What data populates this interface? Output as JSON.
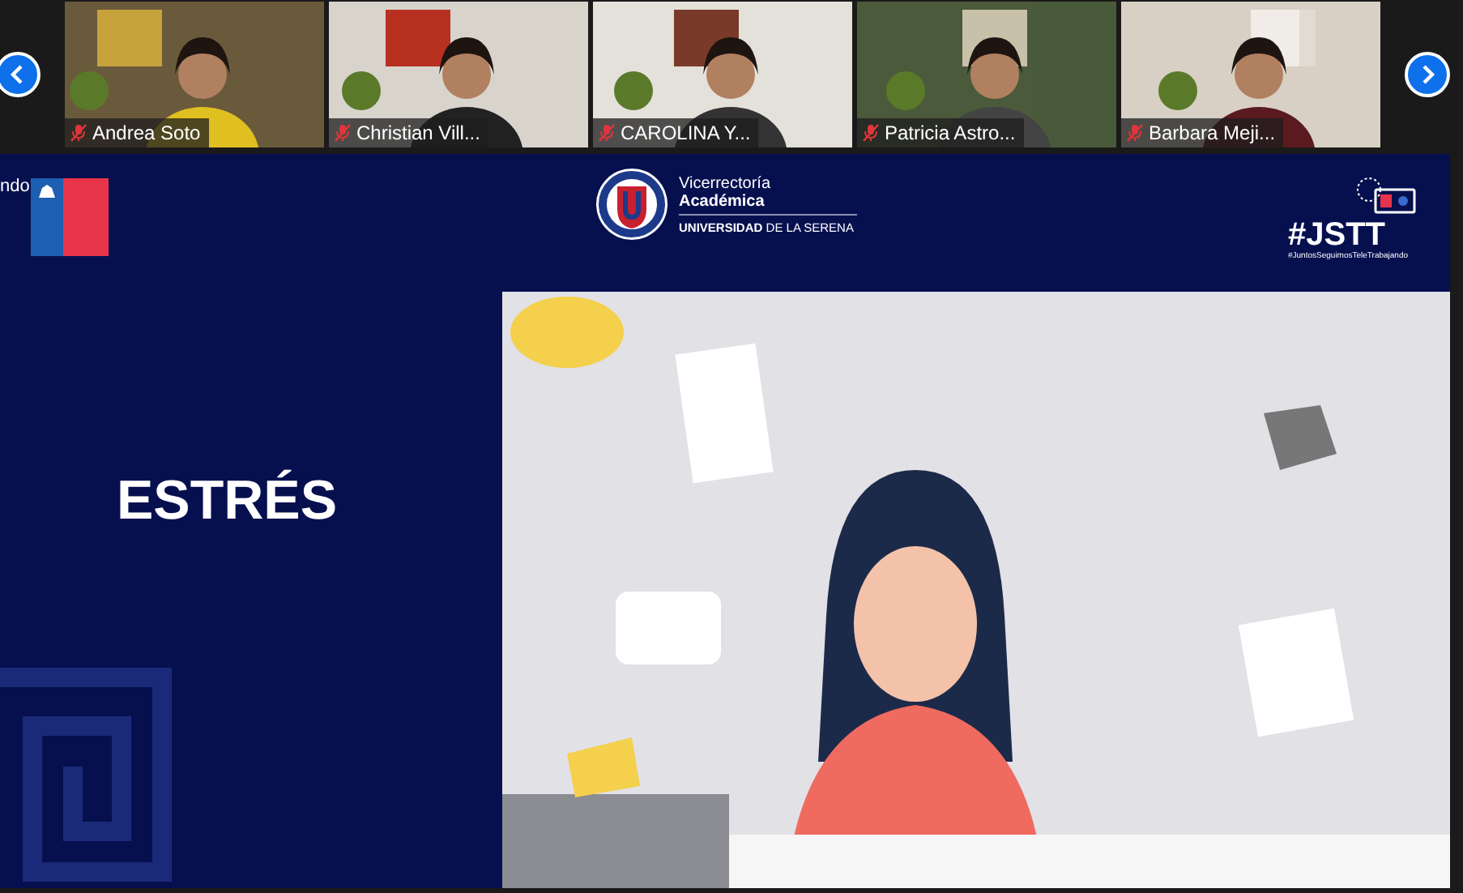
{
  "participants": [
    {
      "name": "Andrea Soto",
      "muted": true
    },
    {
      "name": "Christian Vill...",
      "muted": true
    },
    {
      "name": "CAROLINA Y...",
      "muted": true
    },
    {
      "name": "Patricia Astro...",
      "muted": true
    },
    {
      "name": "Barbara Meji...",
      "muted": true
    }
  ],
  "slide": {
    "edge_text": "ndo",
    "university_logo": {
      "line_1": "Vicerrectoría",
      "line_2": "Académica",
      "name": "**UNIVERSIDAD** DE LA SERENA"
    },
    "campaign_logo": {
      "tag": "#JSTT",
      "subtitle": "#JuntosSeguimosTeleTrabajando"
    },
    "title": "ESTRÉS"
  }
}
